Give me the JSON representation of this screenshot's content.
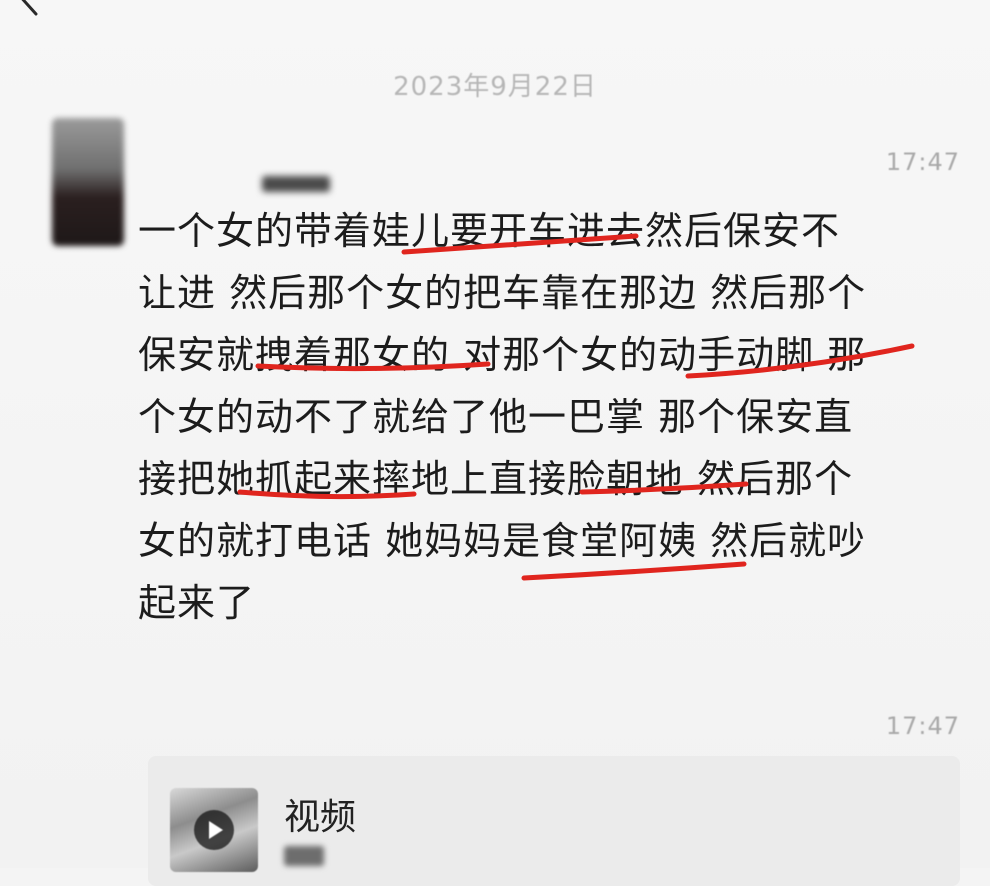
{
  "chat": {
    "date_header": "2023年9月22日",
    "timestamps": [
      "17:47",
      "17:47"
    ],
    "message_lines": [
      "一个女的带着娃儿要开车进去然后保安不",
      "让进 然后那个女的把车靠在那边 然后那个",
      "保安就拽着那女的 对那个女的动手动脚 那",
      "个女的动不了就给了他一巴掌 那个保安直",
      "接把她抓起来摔地上直接脸朝地 然后那个",
      "女的就打电话 她妈妈是食堂阿姨 然后就吵",
      "起来了"
    ],
    "video": {
      "label": "视频"
    }
  },
  "colors": {
    "annotation_red": "#e0251e",
    "background": "#f4f4f4",
    "text": "#1c1c1c",
    "timestamp": "#a9a9a9"
  },
  "icons": [
    "back-chevron-icon",
    "play-icon"
  ]
}
